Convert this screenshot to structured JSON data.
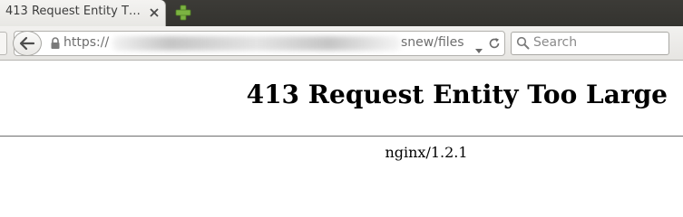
{
  "tab": {
    "title": "413 Request Entity T…",
    "close_icon": "close-icon",
    "new_tab_icon": "plus-icon"
  },
  "toolbar": {
    "back_icon": "arrow-left-icon",
    "lock_icon": "lock-icon",
    "url_prefix": "https://",
    "url_suffix": "snew/files",
    "dropmarker_icon": "chevron-down-icon",
    "reload_icon": "reload-icon",
    "search_placeholder": "Search",
    "search_icon": "magnifier-icon"
  },
  "page": {
    "heading": "413 Request Entity Too Large",
    "server_signature": "nginx/1.2.1"
  },
  "colors": {
    "tabstrip": "#3c3b37",
    "new_tab_plus": "#7cb342",
    "page_background": "#ffffff"
  }
}
